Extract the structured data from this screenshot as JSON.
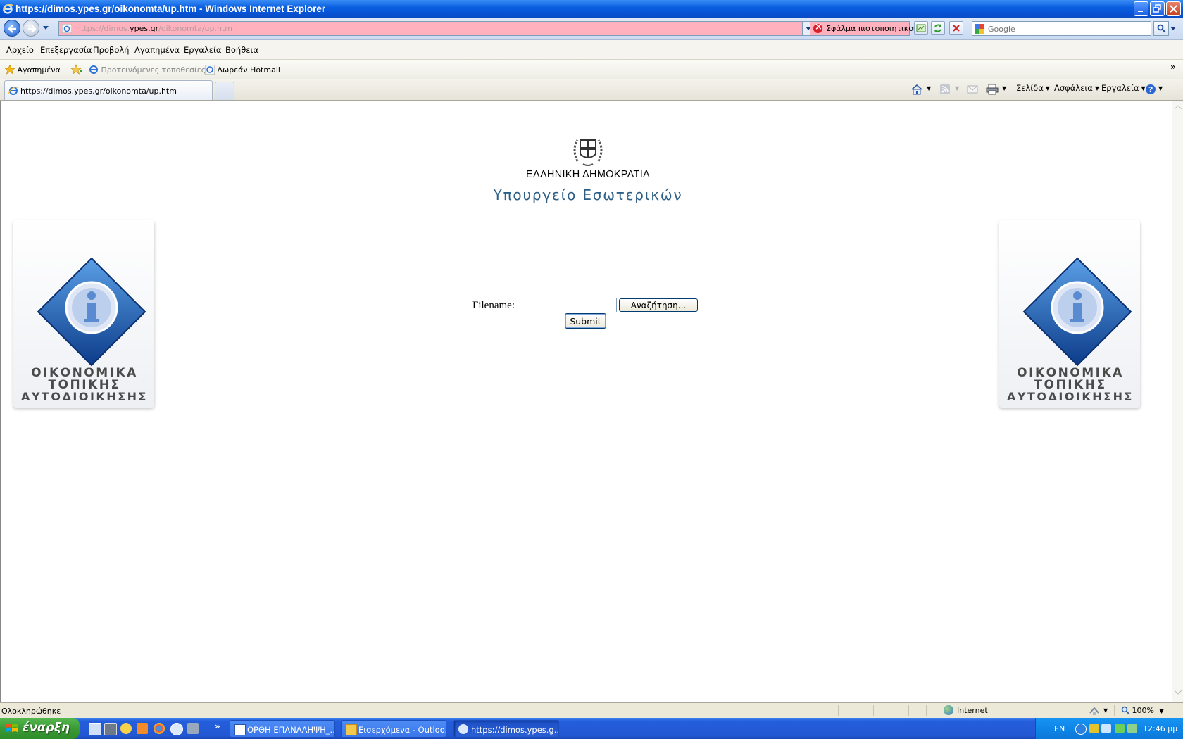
{
  "window": {
    "title": "https://dimos.ypes.gr/oikonomta/up.htm - Windows Internet Explorer"
  },
  "address_bar": {
    "url_prefix": "https://dimos.",
    "url_domain": "ypes.gr",
    "url_suffix": "/oikonomta/up.htm",
    "cert_error": "Σφάλμα πιστοποιητικού"
  },
  "search": {
    "placeholder": "Google"
  },
  "menu": [
    "Αρχείο",
    "Επεξεργασία",
    "Προβολή",
    "Αγαπημένα",
    "Εργαλεία",
    "Βοήθεια"
  ],
  "favorites_bar": {
    "favorites": "Αγαπημένα",
    "suggested_sites": "Προτεινόμενες τοποθεσίες",
    "hotmail": "Δωρεάν Hotmail"
  },
  "tabs": {
    "active_title": "https://dimos.ypes.gr/oikonomta/up.htm"
  },
  "command_bar": {
    "page": "Σελίδα",
    "safety": "Ασφάλεια",
    "tools": "Εργαλεία"
  },
  "page": {
    "header_line1": "ΕΛΛΗΝΙΚΗ ΔΗΜΟΚΡΑΤΙΑ",
    "header_line2": "Υπουργείο Εσωτερικών",
    "logo_text": [
      "ΟΙΚΟΝΟΜΙΚΑ",
      "ΤΟΠΙΚΗΣ",
      "ΑΥΤΟΔΙΟΙΚΗΣΗΣ"
    ],
    "form": {
      "filename_label": "Filename:",
      "filename_value": "",
      "browse_button": "Αναζήτηση...",
      "submit_button": "Submit"
    }
  },
  "status_bar": {
    "status": "Ολοκληρώθηκε",
    "zone": "Internet",
    "zoom": "100%"
  },
  "taskbar": {
    "start": "έναρξη",
    "tasks": [
      "ΟΡΘΗ ΕΠΑΝΑΛΗΨΗ_...",
      "Εισερχόμενα - Outloo...",
      "https://dimos.ypes.g..."
    ],
    "language": "EN",
    "clock": "12:46 μμ"
  },
  "colors": {
    "url_error_bg": "#ffb2bd",
    "ministry_text": "#2c5e86",
    "xp_taskbar": "#245edb",
    "start_button": "#3a9a35"
  }
}
